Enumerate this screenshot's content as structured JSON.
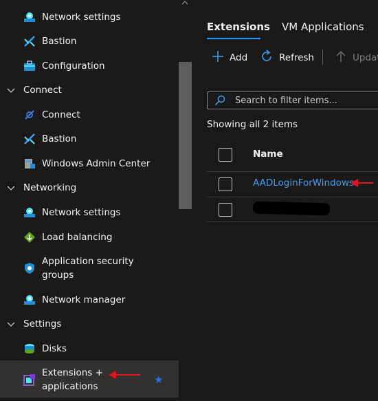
{
  "sidebar": {
    "items": [
      {
        "label": "Network settings",
        "icon": "network-settings-icon"
      },
      {
        "label": "Bastion",
        "icon": "bastion-icon"
      },
      {
        "label": "Configuration",
        "icon": "configuration-icon"
      },
      {
        "group": "Connect"
      },
      {
        "label": "Connect",
        "icon": "connect-icon"
      },
      {
        "label": "Bastion",
        "icon": "bastion-icon"
      },
      {
        "label": "Windows Admin Center",
        "icon": "windows-admin-center-icon"
      },
      {
        "group": "Networking"
      },
      {
        "label": "Network settings",
        "icon": "network-settings-icon"
      },
      {
        "label": "Load balancing",
        "icon": "load-balancing-icon"
      },
      {
        "label": "Application security groups",
        "icon": "application-security-groups-icon"
      },
      {
        "label": "Network manager",
        "icon": "network-manager-icon"
      },
      {
        "group": "Settings"
      },
      {
        "label": "Disks",
        "icon": "disks-icon"
      },
      {
        "label": "Extensions + applications",
        "icon": "extensions-icon",
        "selected": true
      }
    ],
    "favorite_star": "★"
  },
  "tabs": [
    {
      "label": "Extensions",
      "active": true
    },
    {
      "label": "VM Applications",
      "active": false
    }
  ],
  "toolbar": {
    "add_label": "Add",
    "refresh_label": "Refresh",
    "update_label": "Update"
  },
  "search": {
    "placeholder": "Search to filter items..."
  },
  "status_text": "Showing all 2 items",
  "table": {
    "columns": [
      "Name"
    ],
    "rows": [
      {
        "name": "AADLoginForWindows"
      },
      {
        "name": ""
      }
    ]
  },
  "colors": {
    "background": "#1b1a19",
    "accent": "#2899f5",
    "link": "#3aa0f3",
    "annotation_arrow": "#e81123"
  }
}
